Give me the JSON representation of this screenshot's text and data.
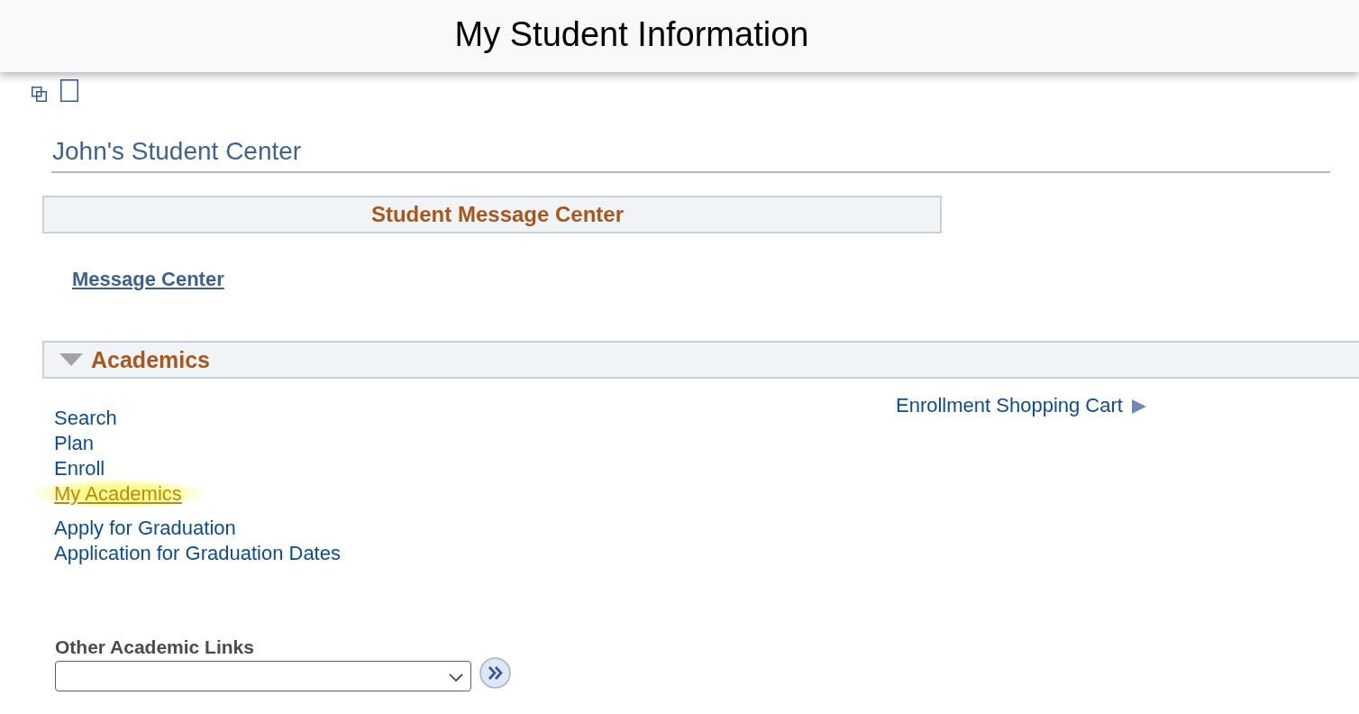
{
  "header": {
    "title": "My Student Information"
  },
  "student_center": {
    "title": "John's Student Center"
  },
  "message_center": {
    "heading": "Student Message Center",
    "link": "Message Center"
  },
  "academics": {
    "heading": "Academics",
    "expanded": true,
    "links": [
      {
        "label": "Search",
        "highlighted": false
      },
      {
        "label": "Plan",
        "highlighted": false
      },
      {
        "label": "Enroll",
        "highlighted": false
      },
      {
        "label": "My Academics",
        "highlighted": true
      },
      {
        "label": "Apply for Graduation",
        "highlighted": false
      },
      {
        "label": "Application for Graduation Dates",
        "highlighted": false
      }
    ],
    "side_link": "Enrollment Shopping Cart",
    "other_links": {
      "label": "Other Academic Links"
    }
  }
}
